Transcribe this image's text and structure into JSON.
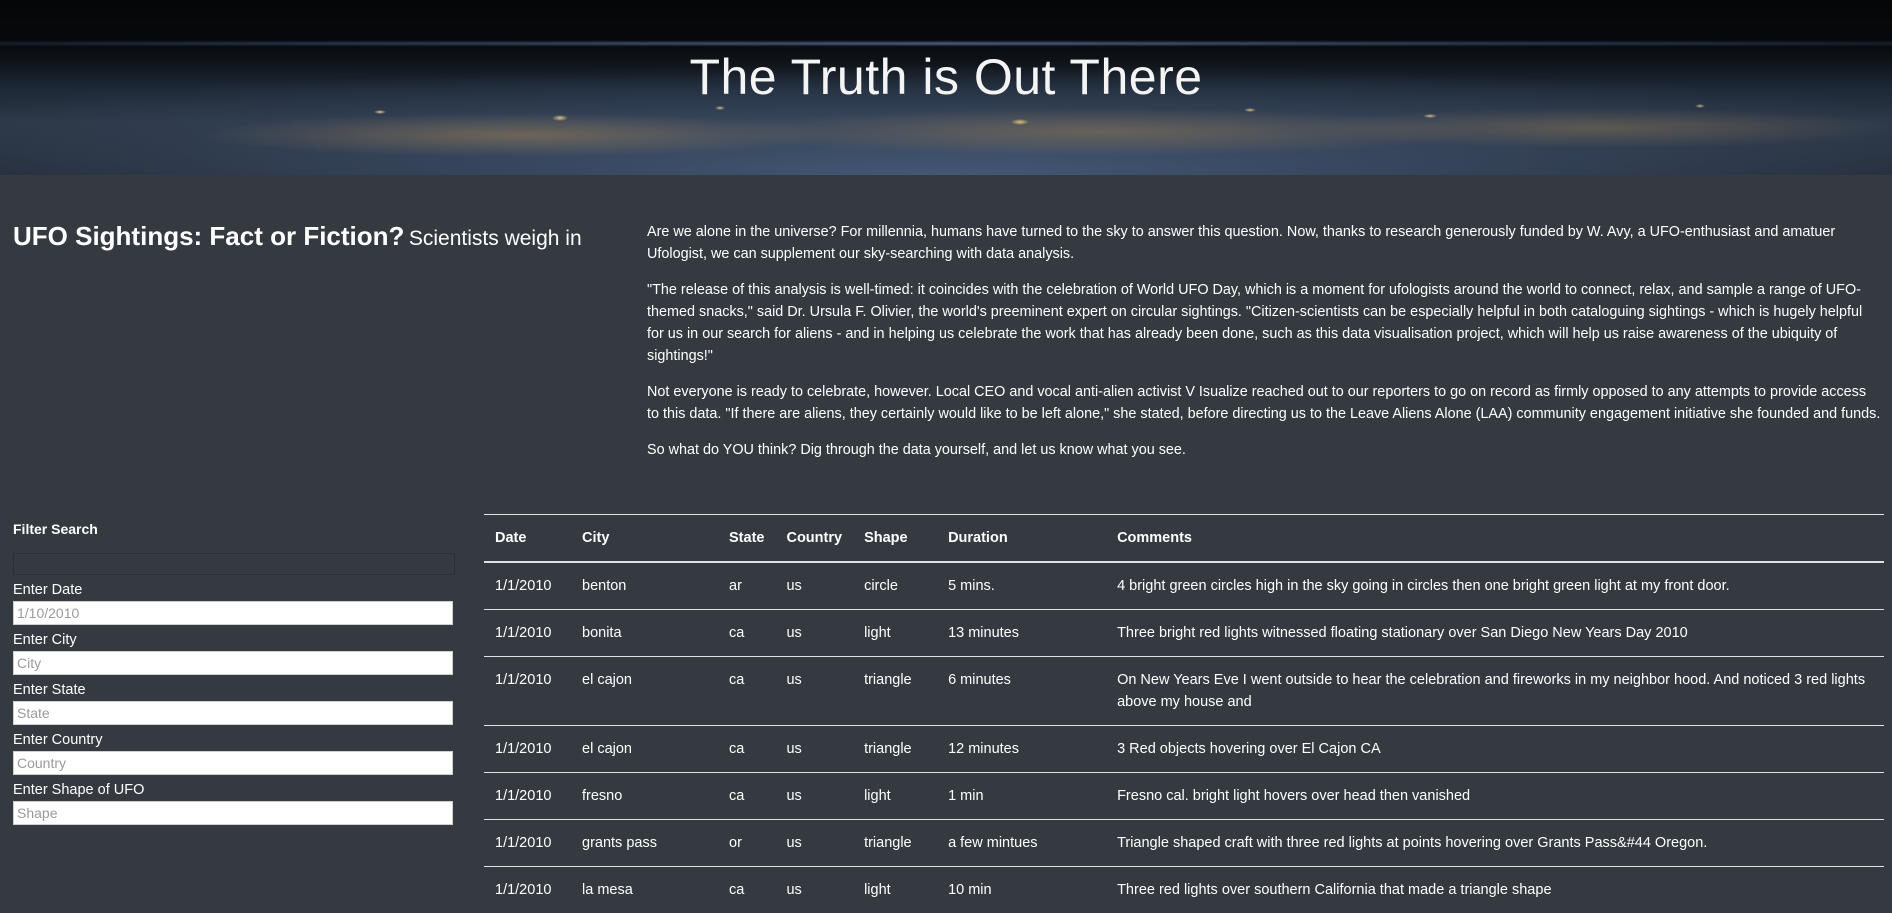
{
  "hero": {
    "title": "The Truth is Out There"
  },
  "intro": {
    "headline": "UFO Sightings: Fact or Fiction?",
    "subheadline": "Scientists weigh in",
    "paragraphs": [
      "Are we alone in the universe? For millennia, humans have turned to the sky to answer this question. Now, thanks to research generously funded by W. Avy, a UFO-enthusiast and amatuer Ufologist, we can supplement our sky-searching with data analysis.",
      "\"The release of this analysis is well-timed: it coincides with the celebration of World UFO Day, which is a moment for ufologists around the world to connect, relax, and sample a range of UFO-themed snacks,\" said Dr. Ursula F. Olivier, the world's preeminent expert on circular sightings. \"Citizen-scientists can be especially helpful in both cataloguing sightings - which is hugely helpful for us in our search for aliens - and in helping us celebrate the work that has already been done, such as this data visualisation project, which will help us raise awareness of the ubiquity of sightings!\"",
      "Not everyone is ready to celebrate, however. Local CEO and vocal anti-alien activist V Isualize reached out to our reporters to go on record as firmly opposed to any attempts to provide access to this data. \"If there are aliens, they certainly would like to be left alone,\" she stated, before directing us to the Leave Aliens Alone (LAA) community engagement initiative she founded and funds.",
      "So what do YOU think? Dig through the data yourself, and let us know what you see."
    ]
  },
  "filters": {
    "heading": "Filter Search",
    "date_label": "Enter Date",
    "date_placeholder": "1/10/2010",
    "city_label": "Enter City",
    "city_placeholder": "City",
    "state_label": "Enter State",
    "state_placeholder": "State",
    "country_label": "Enter Country",
    "country_placeholder": "Country",
    "shape_label": "Enter Shape of UFO",
    "shape_placeholder": "Shape"
  },
  "table": {
    "headers": [
      "Date",
      "City",
      "State",
      "Country",
      "Shape",
      "Duration",
      "Comments"
    ],
    "rows": [
      [
        "1/1/2010",
        "benton",
        "ar",
        "us",
        "circle",
        "5 mins.",
        "4 bright green circles high in the sky going in circles then one bright green light at my front door."
      ],
      [
        "1/1/2010",
        "bonita",
        "ca",
        "us",
        "light",
        "13 minutes",
        "Three bright red lights witnessed floating stationary over San Diego New Years Day 2010"
      ],
      [
        "1/1/2010",
        "el cajon",
        "ca",
        "us",
        "triangle",
        "6 minutes",
        "On New Years Eve I went outside to hear the celebration and fireworks in my neighbor hood. And noticed 3 red lights above my house and"
      ],
      [
        "1/1/2010",
        "el cajon",
        "ca",
        "us",
        "triangle",
        "12 minutes",
        "3 Red objects hovering over El Cajon CA"
      ],
      [
        "1/1/2010",
        "fresno",
        "ca",
        "us",
        "light",
        "1 min",
        "Fresno cal. bright light hovers over head then vanished"
      ],
      [
        "1/1/2010",
        "grants pass",
        "or",
        "us",
        "triangle",
        "a few mintues",
        "Triangle shaped craft with three red lights at points hovering over Grants Pass&#44 Oregon."
      ],
      [
        "1/1/2010",
        "la mesa",
        "ca",
        "us",
        "light",
        "10 min",
        "Three red lights over southern California that made a triangle shape"
      ]
    ]
  }
}
